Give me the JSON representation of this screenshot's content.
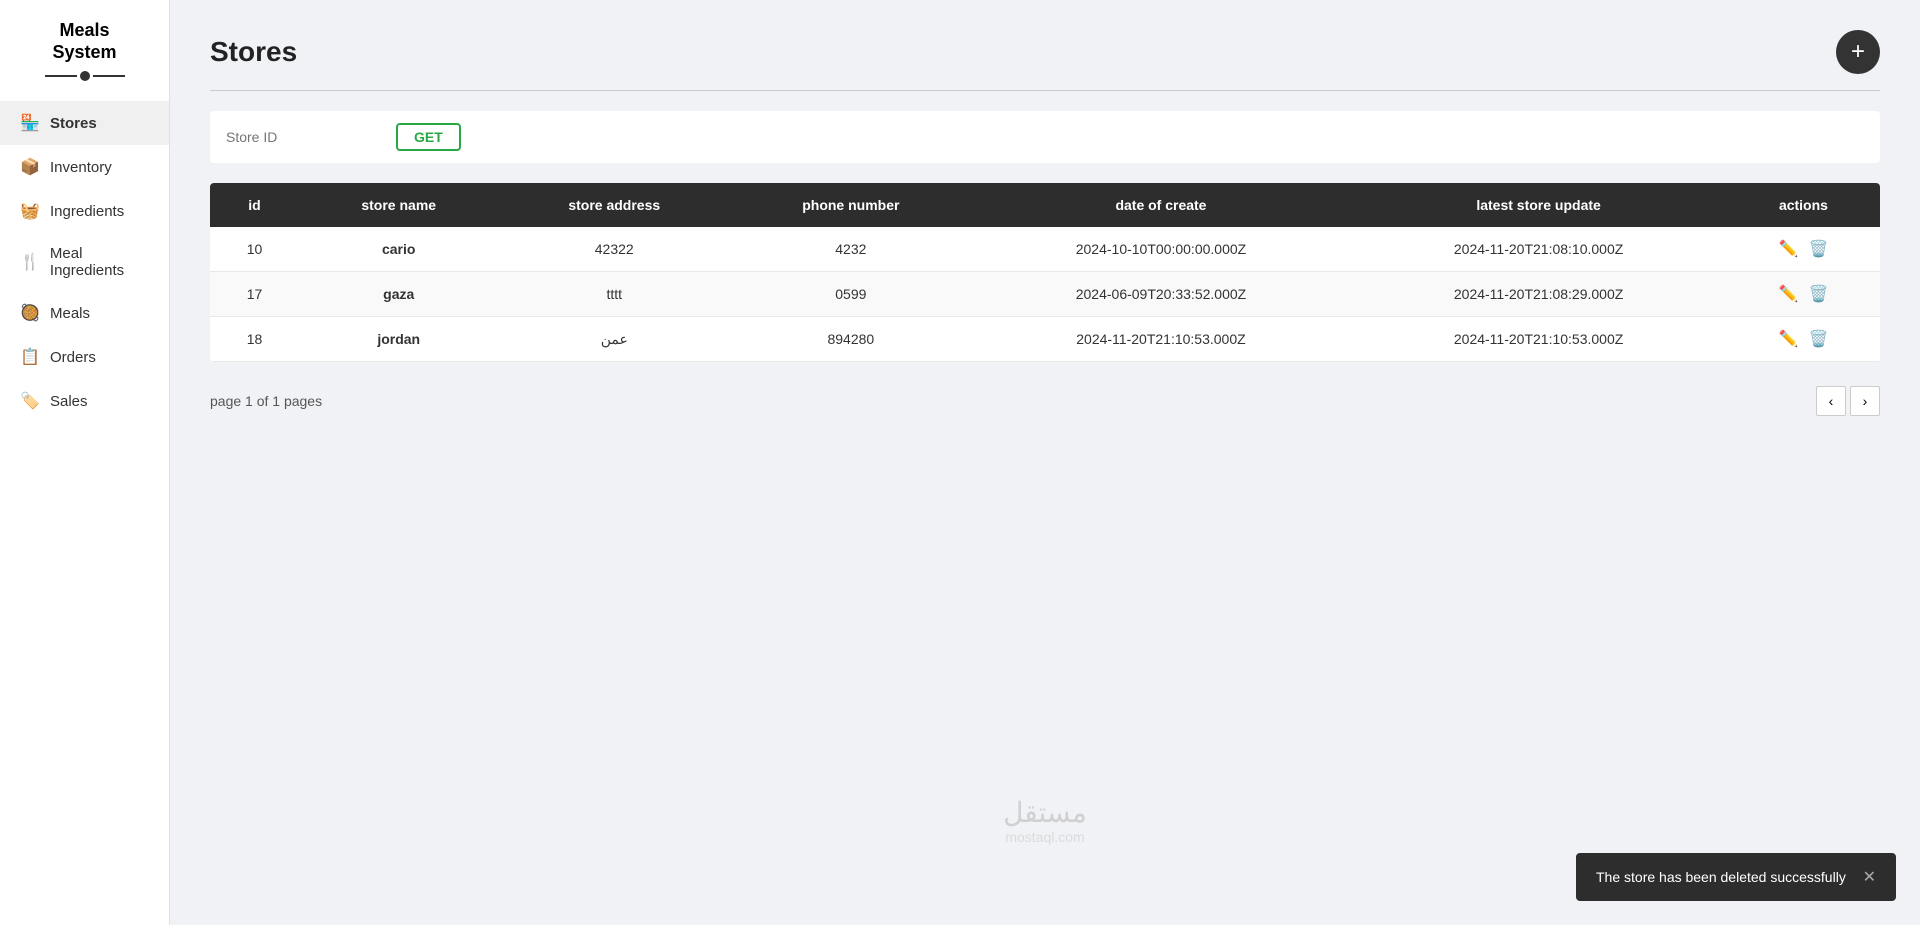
{
  "brand": {
    "line1": "Meals",
    "line2": "System"
  },
  "sidebar": {
    "items": [
      {
        "id": "stores",
        "label": "Stores",
        "icon": "🏪",
        "active": true
      },
      {
        "id": "inventory",
        "label": "Inventory",
        "icon": "📦",
        "active": false
      },
      {
        "id": "ingredients",
        "label": "Ingredients",
        "icon": "🧺",
        "active": false
      },
      {
        "id": "meal-ingredients",
        "label": "Meal Ingredients",
        "icon": "🍴",
        "active": false
      },
      {
        "id": "meals",
        "label": "Meals",
        "icon": "🥘",
        "active": false
      },
      {
        "id": "orders",
        "label": "Orders",
        "icon": "📋",
        "active": false
      },
      {
        "id": "sales",
        "label": "Sales",
        "icon": "🏷️",
        "active": false
      }
    ]
  },
  "page": {
    "title": "Stores",
    "add_button_label": "+"
  },
  "search": {
    "placeholder": "Store ID",
    "get_label": "GET"
  },
  "table": {
    "headers": [
      "id",
      "store name",
      "store address",
      "phone number",
      "date of create",
      "latest store update",
      "actions"
    ],
    "rows": [
      {
        "id": "10",
        "store_name": "cario",
        "store_address": "42322",
        "phone_number": "4232",
        "date_of_create": "2024-10-10T00:00:00.000Z",
        "latest_update": "2024-11-20T21:08:10.000Z"
      },
      {
        "id": "17",
        "store_name": "gaza",
        "store_address": "tttt",
        "phone_number": "0599",
        "date_of_create": "2024-06-09T20:33:52.000Z",
        "latest_update": "2024-11-20T21:08:29.000Z"
      },
      {
        "id": "18",
        "store_name": "jordan",
        "store_address": "عمن",
        "phone_number": "894280",
        "date_of_create": "2024-11-20T21:10:53.000Z",
        "latest_update": "2024-11-20T21:10:53.000Z"
      }
    ]
  },
  "pagination": {
    "info": "page 1 of 1 pages",
    "prev_label": "‹",
    "next_label": "›"
  },
  "toast": {
    "message": "The store has been deleted successfully",
    "close_label": "✕"
  },
  "watermark": {
    "text": "مستقل",
    "sub": "mostaql.com"
  }
}
